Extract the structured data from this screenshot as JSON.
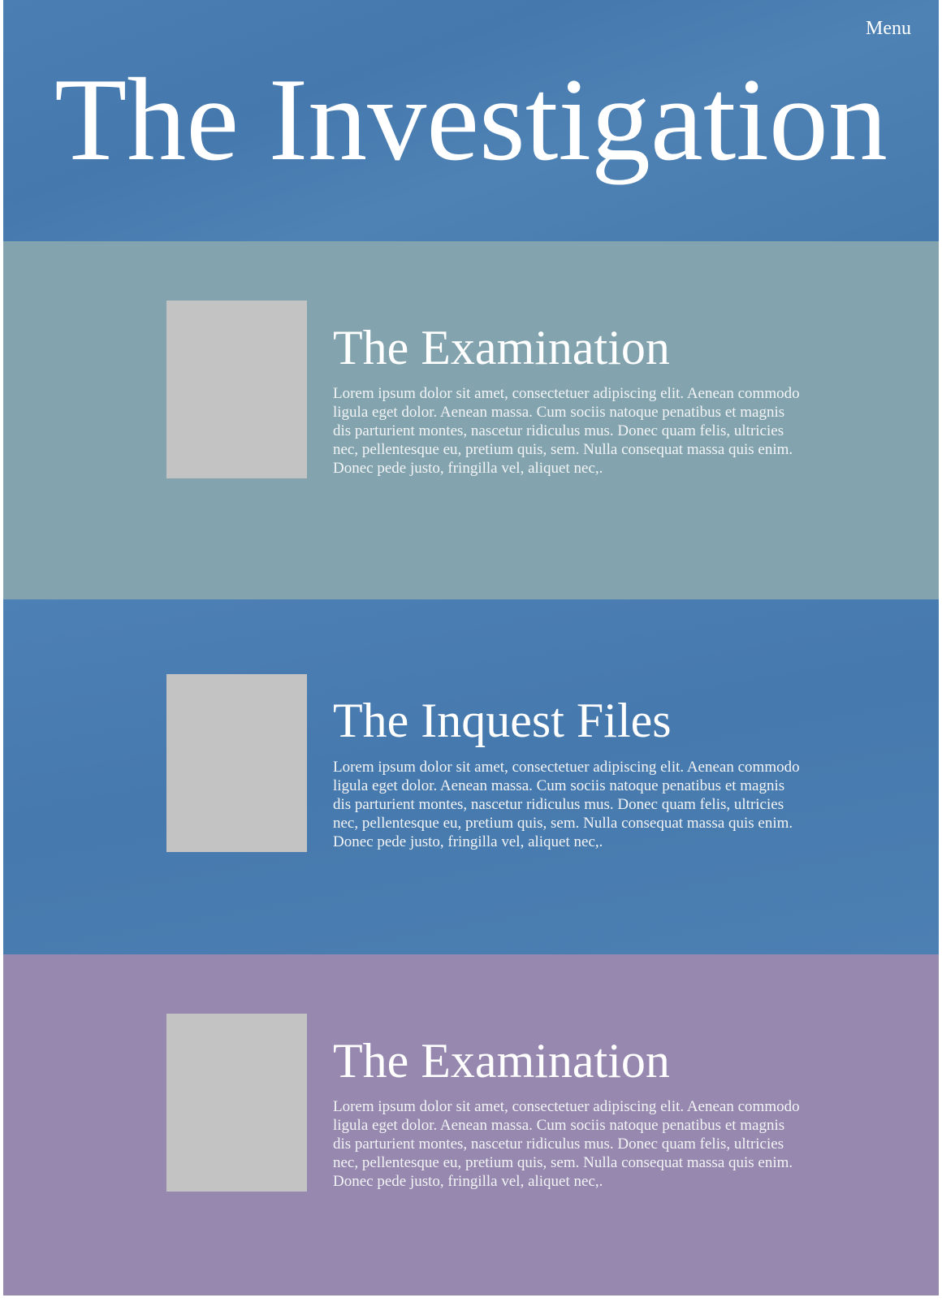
{
  "header": {
    "menu_label": "Menu",
    "title": "The Investigation"
  },
  "sections": [
    {
      "title": "The Examination",
      "body": "Lorem ipsum dolor sit amet, consectetuer adipiscing elit. Aenean commodo ligula eget dolor. Aenean massa. Cum sociis natoque penatibus et magnis dis parturient montes, nascetur ridiculus mus. Donec quam felis, ultricies nec, pellentesque eu, pretium quis, sem. Nulla consequat massa quis enim. Donec pede justo, fringilla vel, aliquet nec,."
    },
    {
      "title": "The Inquest Files",
      "body": "Lorem ipsum dolor sit amet, consectetuer adipiscing elit. Aenean commodo ligula eget dolor. Aenean massa. Cum sociis natoque penatibus et magnis dis parturient montes, nascetur ridiculus mus. Donec quam felis, ultricies nec, pellentesque eu, pretium quis, sem. Nulla consequat massa quis enim. Donec pede justo, fringilla vel, aliquet nec,."
    },
    {
      "title": "The Examination",
      "body": "Lorem ipsum dolor sit amet, consectetuer adipiscing elit. Aenean commodo ligula eget dolor. Aenean massa. Cum sociis natoque penatibus et magnis dis parturient montes, nascetur ridiculus mus. Donec quam felis, ultricies nec, pellentesque eu, pretium quis, sem. Nulla consequat massa quis enim. Donec pede justo, fringilla vel, aliquet nec,."
    }
  ],
  "colors": {
    "header_bg": "#4a7db1",
    "section_1_bg": "#83a4ae",
    "section_2_bg": "#4a7db1",
    "section_3_bg": "#9688ae",
    "thumbnail": "#c3c3c3",
    "text": "#ffffff"
  }
}
